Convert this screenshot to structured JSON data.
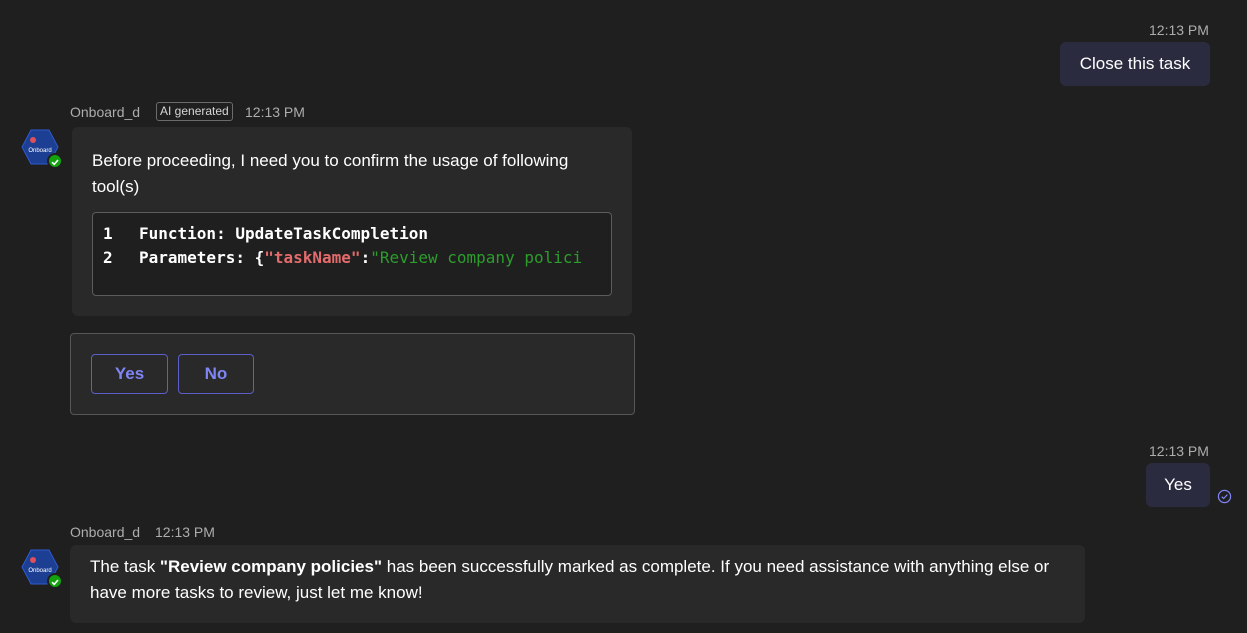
{
  "messages": {
    "user1": {
      "time": "12:13 PM",
      "text": "Close this task"
    },
    "bot1": {
      "sender": "Onboard_d",
      "badge": "AI generated",
      "time": "12:13 PM",
      "text": "Before proceeding, I need you to confirm the usage of following tool(s)",
      "code": {
        "line1_num": "1",
        "line1_text": "Function: UpdateTaskCompletion",
        "line2_num": "2",
        "line2_label": "Parameters: {",
        "line2_key": "\"taskName\"",
        "line2_colon": ":",
        "line2_value": "\"Review company polici"
      }
    },
    "card": {
      "yes_label": "Yes",
      "no_label": "No"
    },
    "user2": {
      "time": "12:13 PM",
      "text": "Yes"
    },
    "bot2": {
      "sender": "Onboard_d",
      "time": "12:13 PM",
      "text_before": "The task ",
      "text_bold": "\"Review company policies\"",
      "text_after": " has been successfully marked as complete. If you need assistance with anything else or have more tasks to review, just let me know!"
    }
  },
  "avatar": {
    "label": "Onboard.ai",
    "color": "#1c3f94"
  },
  "colors": {
    "background": "#1f1f1f",
    "user_bubble": "#2b2b40",
    "bot_bubble": "#292929",
    "accent": "#7f85f5",
    "presence": "#13a10e"
  }
}
